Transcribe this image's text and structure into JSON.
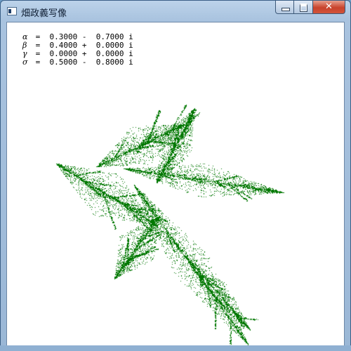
{
  "window": {
    "title": "畑政義写像",
    "controls": {
      "minimize": "minimize",
      "maximize": "maximize",
      "close": "close"
    }
  },
  "parameters": [
    {
      "symbol": "α",
      "value": " =  0.3000 -  0.7000 i"
    },
    {
      "symbol": "β",
      "value": " =  0.4000 +  0.0000 i"
    },
    {
      "symbol": "γ",
      "value": " =  0.0000 +  0.0000 i"
    },
    {
      "symbol": "σ",
      "value": " =  0.5000 -  0.8000 i"
    }
  ],
  "colors": {
    "fractal": "#007700",
    "background": "#ffffff"
  },
  "icons": [
    "app-icon",
    "minimize-icon",
    "maximize-icon",
    "close-icon"
  ]
}
